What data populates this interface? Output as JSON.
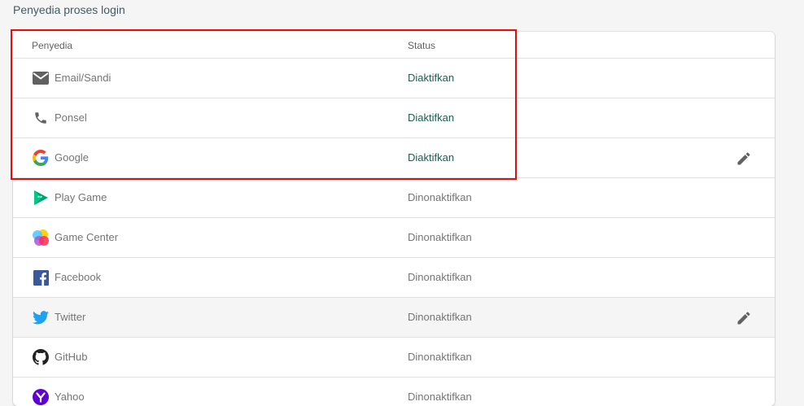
{
  "section": {
    "title": "Penyedia proses login"
  },
  "table": {
    "headers": {
      "provider": "Penyedia",
      "status": "Status"
    },
    "rows": [
      {
        "name": "Email/Sandi",
        "status": "Diaktifkan",
        "icon": "mail-icon"
      },
      {
        "name": "Ponsel",
        "status": "Diaktifkan",
        "icon": "phone-icon"
      },
      {
        "name": "Google",
        "status": "Diaktifkan",
        "icon": "google-icon"
      },
      {
        "name": "Play Game",
        "status": "Dinonaktifkan",
        "icon": "play-games-icon"
      },
      {
        "name": "Game Center",
        "status": "Dinonaktifkan",
        "icon": "game-center-icon"
      },
      {
        "name": "Facebook",
        "status": "Dinonaktifkan",
        "icon": "facebook-icon"
      },
      {
        "name": "Twitter",
        "status": "Dinonaktifkan",
        "icon": "twitter-icon"
      },
      {
        "name": "GitHub",
        "status": "Dinonaktifkan",
        "icon": "github-icon"
      },
      {
        "name": "Yahoo",
        "status": "Dinonaktifkan",
        "icon": "yahoo-icon"
      }
    ]
  },
  "colors": {
    "enabled": "#1b5e4f",
    "disabled": "#757575",
    "highlight": "#e01010"
  }
}
